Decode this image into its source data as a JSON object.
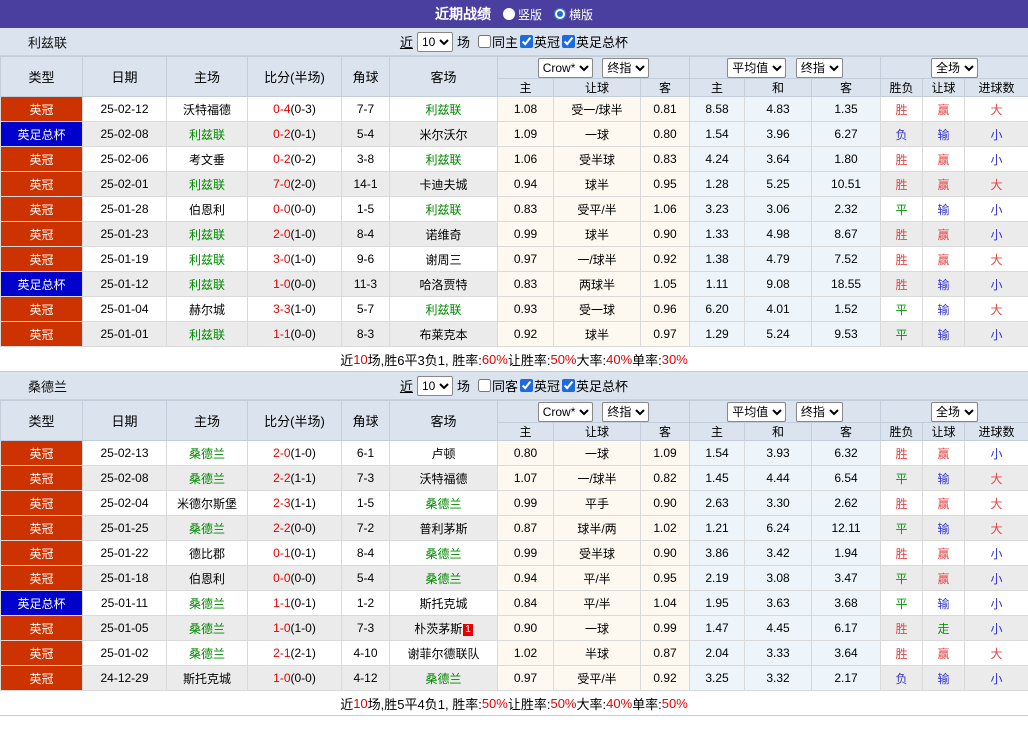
{
  "title_bar": {
    "title": "近期战绩",
    "radios": [
      {
        "label": "竖版",
        "selected": false
      },
      {
        "label": "横版",
        "selected": true
      }
    ]
  },
  "filter": {
    "near": "近",
    "count": "10",
    "games": "场"
  },
  "columns": {
    "type": "类型",
    "date": "日期",
    "home": "主场",
    "score": "比分(半场)",
    "corner": "角球",
    "away": "客场",
    "dropdowns": [
      "Crow*",
      "终指",
      "平均值",
      "终指",
      "全场"
    ],
    "sub": [
      "主",
      "让球",
      "客",
      "主",
      "和",
      "客",
      "胜负",
      "让球",
      "进球数"
    ]
  },
  "colors": {
    "title_purple": "#4a3f9e",
    "league_badge": "#cc3300",
    "cup_badge": "#0000cc",
    "team_green": "#008800",
    "score_red": "#e60000",
    "result_red": "#e64444",
    "result_blue": "#3333cc",
    "result_green": "#009900"
  },
  "sections": [
    {
      "team": "利兹联",
      "same_side_label": "同主",
      "same_side_checked": false,
      "league_label": "英冠",
      "league_checked": true,
      "cup_label": "英足总杯",
      "cup_checked": true,
      "rows": [
        {
          "type": "英冠",
          "cup": false,
          "date": "25-02-12",
          "home": "沃特福德",
          "home_is_team": false,
          "ft": "0-4",
          "ht": "(0-3)",
          "corner": "7-7",
          "away": "利兹联",
          "away_is_team": true,
          "away_badge": "",
          "o_home": "1.08",
          "handicap": "受一/球半",
          "o_away": "0.81",
          "avg_home": "8.58",
          "avg_draw": "4.83",
          "avg_away": "1.35",
          "res": [
            "胜",
            "赢",
            "大"
          ],
          "res_c": [
            "r",
            "r",
            "r"
          ]
        },
        {
          "type": "英足总杯",
          "cup": true,
          "date": "25-02-08",
          "home": "利兹联",
          "home_is_team": true,
          "ft": "0-2",
          "ht": "(0-1)",
          "corner": "5-4",
          "away": "米尔沃尔",
          "away_is_team": false,
          "away_badge": "",
          "o_home": "1.09",
          "handicap": "一球",
          "o_away": "0.80",
          "avg_home": "1.54",
          "avg_draw": "3.96",
          "avg_away": "6.27",
          "res": [
            "负",
            "输",
            "小"
          ],
          "res_c": [
            "b",
            "b",
            "b"
          ]
        },
        {
          "type": "英冠",
          "cup": false,
          "date": "25-02-06",
          "home": "考文垂",
          "home_is_team": false,
          "ft": "0-2",
          "ht": "(0-2)",
          "corner": "3-8",
          "away": "利兹联",
          "away_is_team": true,
          "away_badge": "",
          "o_home": "1.06",
          "handicap": "受半球",
          "o_away": "0.83",
          "avg_home": "4.24",
          "avg_draw": "3.64",
          "avg_away": "1.80",
          "res": [
            "胜",
            "赢",
            "小"
          ],
          "res_c": [
            "r",
            "r",
            "b"
          ]
        },
        {
          "type": "英冠",
          "cup": false,
          "date": "25-02-01",
          "home": "利兹联",
          "home_is_team": true,
          "ft": "7-0",
          "ht": "(2-0)",
          "corner": "14-1",
          "away": "卡迪夫城",
          "away_is_team": false,
          "away_badge": "",
          "o_home": "0.94",
          "handicap": "球半",
          "o_away": "0.95",
          "avg_home": "1.28",
          "avg_draw": "5.25",
          "avg_away": "10.51",
          "res": [
            "胜",
            "赢",
            "大"
          ],
          "res_c": [
            "r",
            "r",
            "r"
          ]
        },
        {
          "type": "英冠",
          "cup": false,
          "date": "25-01-28",
          "home": "伯恩利",
          "home_is_team": false,
          "ft": "0-0",
          "ht": "(0-0)",
          "corner": "1-5",
          "away": "利兹联",
          "away_is_team": true,
          "away_badge": "",
          "o_home": "0.83",
          "handicap": "受平/半",
          "o_away": "1.06",
          "avg_home": "3.23",
          "avg_draw": "3.06",
          "avg_away": "2.32",
          "res": [
            "平",
            "输",
            "小"
          ],
          "res_c": [
            "g",
            "b",
            "b"
          ]
        },
        {
          "type": "英冠",
          "cup": false,
          "date": "25-01-23",
          "home": "利兹联",
          "home_is_team": true,
          "ft": "2-0",
          "ht": "(1-0)",
          "corner": "8-4",
          "away": "诺维奇",
          "away_is_team": false,
          "away_badge": "",
          "o_home": "0.99",
          "handicap": "球半",
          "o_away": "0.90",
          "avg_home": "1.33",
          "avg_draw": "4.98",
          "avg_away": "8.67",
          "res": [
            "胜",
            "赢",
            "小"
          ],
          "res_c": [
            "r",
            "r",
            "b"
          ]
        },
        {
          "type": "英冠",
          "cup": false,
          "date": "25-01-19",
          "home": "利兹联",
          "home_is_team": true,
          "ft": "3-0",
          "ht": "(1-0)",
          "corner": "9-6",
          "away": "谢周三",
          "away_is_team": false,
          "away_badge": "",
          "o_home": "0.97",
          "handicap": "一/球半",
          "o_away": "0.92",
          "avg_home": "1.38",
          "avg_draw": "4.79",
          "avg_away": "7.52",
          "res": [
            "胜",
            "赢",
            "大"
          ],
          "res_c": [
            "r",
            "r",
            "r"
          ]
        },
        {
          "type": "英足总杯",
          "cup": true,
          "date": "25-01-12",
          "home": "利兹联",
          "home_is_team": true,
          "ft": "1-0",
          "ht": "(0-0)",
          "corner": "11-3",
          "away": "哈洛贾特",
          "away_is_team": false,
          "away_badge": "",
          "o_home": "0.83",
          "handicap": "两球半",
          "o_away": "1.05",
          "avg_home": "1.11",
          "avg_draw": "9.08",
          "avg_away": "18.55",
          "res": [
            "胜",
            "输",
            "小"
          ],
          "res_c": [
            "r",
            "b",
            "b"
          ]
        },
        {
          "type": "英冠",
          "cup": false,
          "date": "25-01-04",
          "home": "赫尔城",
          "home_is_team": false,
          "ft": "3-3",
          "ht": "(1-0)",
          "corner": "5-7",
          "away": "利兹联",
          "away_is_team": true,
          "away_badge": "",
          "o_home": "0.93",
          "handicap": "受一球",
          "o_away": "0.96",
          "avg_home": "6.20",
          "avg_draw": "4.01",
          "avg_away": "1.52",
          "res": [
            "平",
            "输",
            "大"
          ],
          "res_c": [
            "g",
            "b",
            "r"
          ]
        },
        {
          "type": "英冠",
          "cup": false,
          "date": "25-01-01",
          "home": "利兹联",
          "home_is_team": true,
          "ft": "1-1",
          "ht": "(0-0)",
          "corner": "8-3",
          "away": "布莱克本",
          "away_is_team": false,
          "away_badge": "",
          "o_home": "0.92",
          "handicap": "球半",
          "o_away": "0.97",
          "avg_home": "1.29",
          "avg_draw": "5.24",
          "avg_away": "9.53",
          "res": [
            "平",
            "输",
            "小"
          ],
          "res_c": [
            "g",
            "b",
            "b"
          ]
        }
      ],
      "summary": [
        {
          "t": "近",
          "c": "k"
        },
        {
          "t": "10",
          "c": "r"
        },
        {
          "t": "场,胜6平3负1, 胜率:",
          "c": "k"
        },
        {
          "t": "60%",
          "c": "r"
        },
        {
          "t": " 让胜率:",
          "c": "k"
        },
        {
          "t": "50%",
          "c": "r"
        },
        {
          "t": " 大率:",
          "c": "k"
        },
        {
          "t": "40%",
          "c": "r"
        },
        {
          "t": " 单率:",
          "c": "k"
        },
        {
          "t": "30%",
          "c": "r"
        }
      ]
    },
    {
      "team": "桑德兰",
      "same_side_label": "同客",
      "same_side_checked": false,
      "league_label": "英冠",
      "league_checked": true,
      "cup_label": "英足总杯",
      "cup_checked": true,
      "rows": [
        {
          "type": "英冠",
          "cup": false,
          "date": "25-02-13",
          "home": "桑德兰",
          "home_is_team": true,
          "ft": "2-0",
          "ht": "(1-0)",
          "corner": "6-1",
          "away": "卢顿",
          "away_is_team": false,
          "away_badge": "",
          "o_home": "0.80",
          "handicap": "一球",
          "o_away": "1.09",
          "avg_home": "1.54",
          "avg_draw": "3.93",
          "avg_away": "6.32",
          "res": [
            "胜",
            "赢",
            "小"
          ],
          "res_c": [
            "r",
            "r",
            "b"
          ]
        },
        {
          "type": "英冠",
          "cup": false,
          "date": "25-02-08",
          "home": "桑德兰",
          "home_is_team": true,
          "ft": "2-2",
          "ht": "(1-1)",
          "corner": "7-3",
          "away": "沃特福德",
          "away_is_team": false,
          "away_badge": "",
          "o_home": "1.07",
          "handicap": "一/球半",
          "o_away": "0.82",
          "avg_home": "1.45",
          "avg_draw": "4.44",
          "avg_away": "6.54",
          "res": [
            "平",
            "输",
            "大"
          ],
          "res_c": [
            "g",
            "b",
            "r"
          ]
        },
        {
          "type": "英冠",
          "cup": false,
          "date": "25-02-04",
          "home": "米德尔斯堡",
          "home_is_team": false,
          "ft": "2-3",
          "ht": "(1-1)",
          "corner": "1-5",
          "away": "桑德兰",
          "away_is_team": true,
          "away_badge": "",
          "o_home": "0.99",
          "handicap": "平手",
          "o_away": "0.90",
          "avg_home": "2.63",
          "avg_draw": "3.30",
          "avg_away": "2.62",
          "res": [
            "胜",
            "赢",
            "大"
          ],
          "res_c": [
            "r",
            "r",
            "r"
          ]
        },
        {
          "type": "英冠",
          "cup": false,
          "date": "25-01-25",
          "home": "桑德兰",
          "home_is_team": true,
          "ft": "2-2",
          "ht": "(0-0)",
          "corner": "7-2",
          "away": "普利茅斯",
          "away_is_team": false,
          "away_badge": "",
          "o_home": "0.87",
          "handicap": "球半/两",
          "o_away": "1.02",
          "avg_home": "1.21",
          "avg_draw": "6.24",
          "avg_away": "12.11",
          "res": [
            "平",
            "输",
            "大"
          ],
          "res_c": [
            "g",
            "b",
            "r"
          ]
        },
        {
          "type": "英冠",
          "cup": false,
          "date": "25-01-22",
          "home": "德比郡",
          "home_is_team": false,
          "ft": "0-1",
          "ht": "(0-1)",
          "corner": "8-4",
          "away": "桑德兰",
          "away_is_team": true,
          "away_badge": "",
          "o_home": "0.99",
          "handicap": "受半球",
          "o_away": "0.90",
          "avg_home": "3.86",
          "avg_draw": "3.42",
          "avg_away": "1.94",
          "res": [
            "胜",
            "赢",
            "小"
          ],
          "res_c": [
            "r",
            "r",
            "b"
          ]
        },
        {
          "type": "英冠",
          "cup": false,
          "date": "25-01-18",
          "home": "伯恩利",
          "home_is_team": false,
          "ft": "0-0",
          "ht": "(0-0)",
          "corner": "5-4",
          "away": "桑德兰",
          "away_is_team": true,
          "away_badge": "",
          "o_home": "0.94",
          "handicap": "平/半",
          "o_away": "0.95",
          "avg_home": "2.19",
          "avg_draw": "3.08",
          "avg_away": "3.47",
          "res": [
            "平",
            "赢",
            "小"
          ],
          "res_c": [
            "g",
            "r",
            "b"
          ]
        },
        {
          "type": "英足总杯",
          "cup": true,
          "date": "25-01-11",
          "home": "桑德兰",
          "home_is_team": true,
          "ft": "1-1",
          "ht": "(0-1)",
          "corner": "1-2",
          "away": "斯托克城",
          "away_is_team": false,
          "away_badge": "",
          "o_home": "0.84",
          "handicap": "平/半",
          "o_away": "1.04",
          "avg_home": "1.95",
          "avg_draw": "3.63",
          "avg_away": "3.68",
          "res": [
            "平",
            "输",
            "小"
          ],
          "res_c": [
            "g",
            "b",
            "b"
          ]
        },
        {
          "type": "英冠",
          "cup": false,
          "date": "25-01-05",
          "home": "桑德兰",
          "home_is_team": true,
          "ft": "1-0",
          "ht": "(1-0)",
          "corner": "7-3",
          "away": "朴茨茅斯",
          "away_is_team": false,
          "away_badge": "1",
          "o_home": "0.90",
          "handicap": "一球",
          "o_away": "0.99",
          "avg_home": "1.47",
          "avg_draw": "4.45",
          "avg_away": "6.17",
          "res": [
            "胜",
            "走",
            "小"
          ],
          "res_c": [
            "r",
            "g",
            "b"
          ]
        },
        {
          "type": "英冠",
          "cup": false,
          "date": "25-01-02",
          "home": "桑德兰",
          "home_is_team": true,
          "ft": "2-1",
          "ht": "(2-1)",
          "corner": "4-10",
          "away": "谢菲尔德联队",
          "away_is_team": false,
          "away_badge": "",
          "o_home": "1.02",
          "handicap": "半球",
          "o_away": "0.87",
          "avg_home": "2.04",
          "avg_draw": "3.33",
          "avg_away": "3.64",
          "res": [
            "胜",
            "赢",
            "大"
          ],
          "res_c": [
            "r",
            "r",
            "r"
          ]
        },
        {
          "type": "英冠",
          "cup": false,
          "date": "24-12-29",
          "home": "斯托克城",
          "home_is_team": false,
          "ft": "1-0",
          "ht": "(0-0)",
          "corner": "4-12",
          "away": "桑德兰",
          "away_is_team": true,
          "away_badge": "",
          "o_home": "0.97",
          "handicap": "受平/半",
          "o_away": "0.92",
          "avg_home": "3.25",
          "avg_draw": "3.32",
          "avg_away": "2.17",
          "res": [
            "负",
            "输",
            "小"
          ],
          "res_c": [
            "b",
            "b",
            "b"
          ]
        }
      ],
      "summary": [
        {
          "t": "近",
          "c": "k"
        },
        {
          "t": "10",
          "c": "r"
        },
        {
          "t": "场,胜5平4负1, 胜率:",
          "c": "k"
        },
        {
          "t": "50%",
          "c": "r"
        },
        {
          "t": " 让胜率:",
          "c": "k"
        },
        {
          "t": "50%",
          "c": "r"
        },
        {
          "t": " 大率:",
          "c": "k"
        },
        {
          "t": "40%",
          "c": "r"
        },
        {
          "t": " 单率:",
          "c": "k"
        },
        {
          "t": "50%",
          "c": "r"
        }
      ]
    }
  ]
}
